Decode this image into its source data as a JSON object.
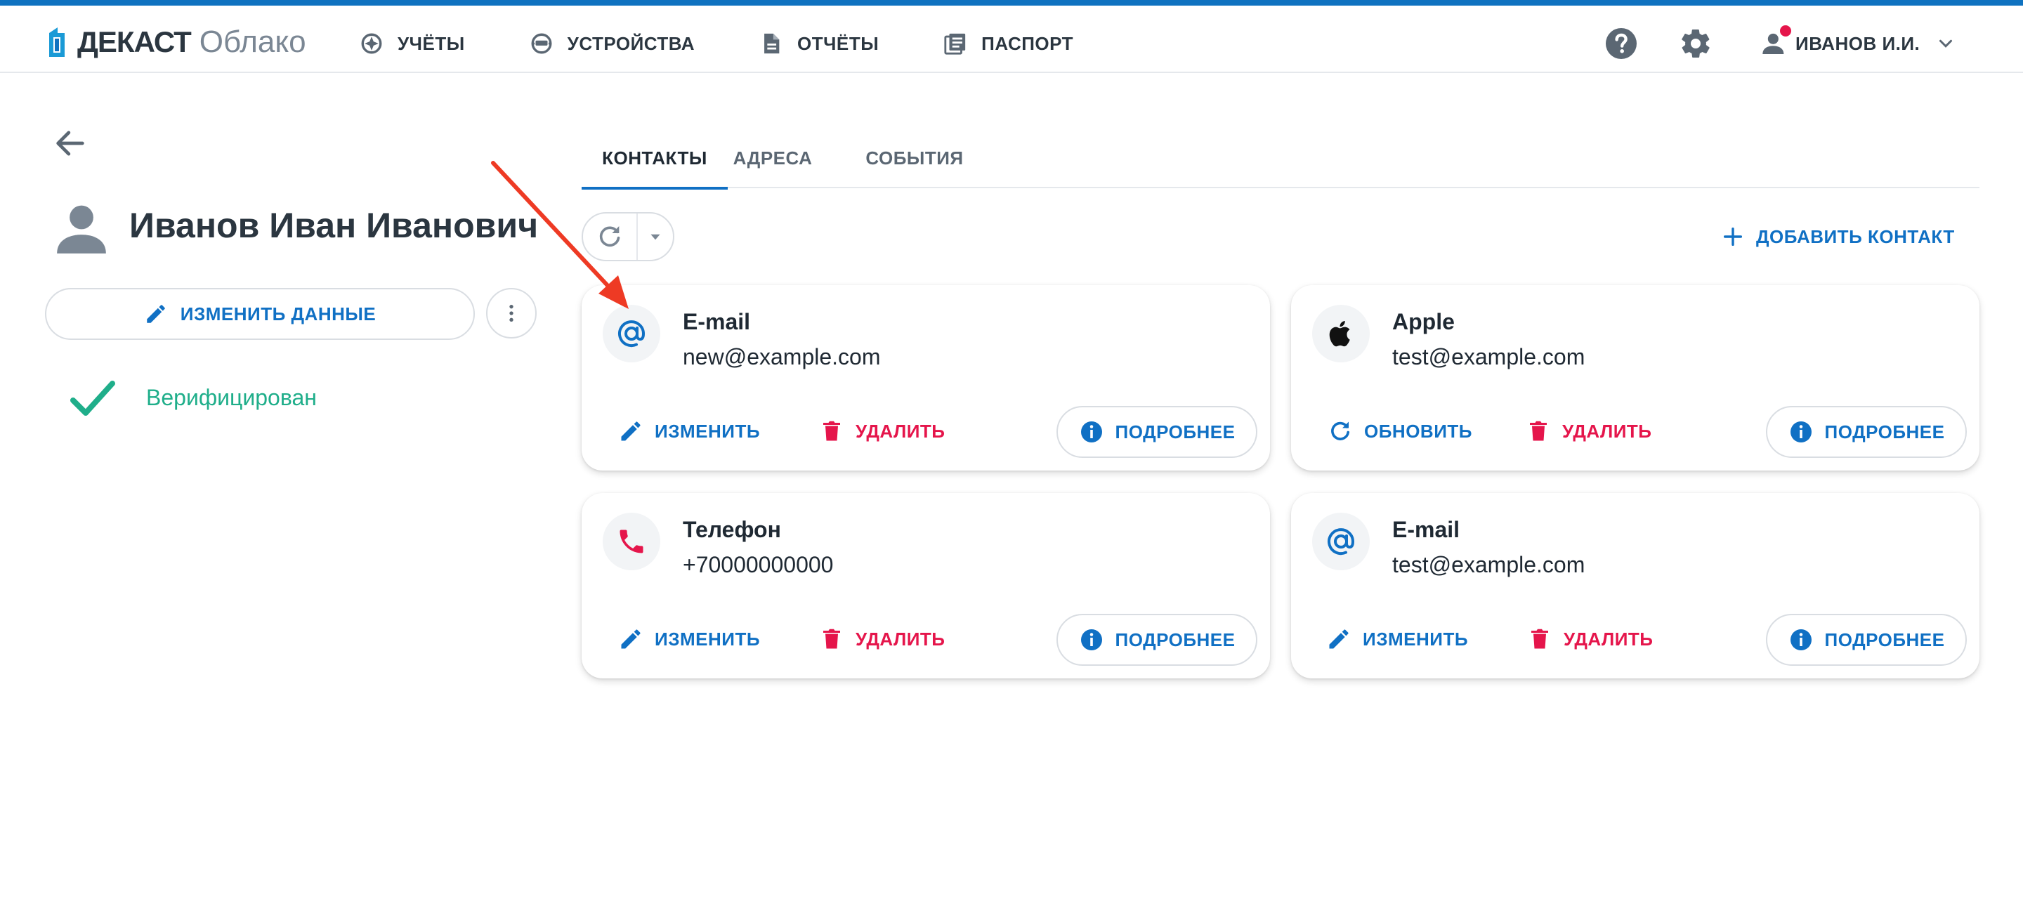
{
  "header": {
    "logo_main": "ДЕКАСТ",
    "logo_sub": "Облако",
    "nav": [
      {
        "label": "УЧЁТЫ",
        "icon": "accounts-icon"
      },
      {
        "label": "УСТРОЙСТВА",
        "icon": "devices-icon"
      },
      {
        "label": "ОТЧЁТЫ",
        "icon": "reports-icon"
      },
      {
        "label": "ПАСПОРТ",
        "icon": "passport-icon"
      }
    ],
    "user_name": "ИВАНОВ И.И."
  },
  "profile": {
    "name": "Иванов Иван Иванович",
    "edit_label": "ИЗМЕНИТЬ ДАННЫЕ",
    "status": "Верифицирован"
  },
  "tabs": [
    {
      "label": "КОНТАКТЫ",
      "active": true
    },
    {
      "label": "АДРЕСА",
      "active": false
    },
    {
      "label": "СОБЫТИЯ",
      "active": false
    }
  ],
  "toolbar": {
    "add_contact_label": "ДОБАВИТЬ КОНТАКТ"
  },
  "cards": [
    {
      "type": "E-mail",
      "value": "new@example.com",
      "icon": "at-icon",
      "primary_action": "ИЗМЕНИТЬ",
      "delete_action": "УДАЛИТЬ",
      "details_action": "ПОДРОБНЕЕ"
    },
    {
      "type": "Apple",
      "value": "test@example.com",
      "icon": "apple-icon",
      "primary_action": "ОБНОВИТЬ",
      "delete_action": "УДАЛИТЬ",
      "details_action": "ПОДРОБНЕЕ"
    },
    {
      "type": "Телефон",
      "value": "+70000000000",
      "icon": "phone-icon",
      "primary_action": "ИЗМЕНИТЬ",
      "delete_action": "УДАЛИТЬ",
      "details_action": "ПОДРОБНЕЕ"
    },
    {
      "type": "E-mail",
      "value": "test@example.com",
      "icon": "at-icon",
      "primary_action": "ИЗМЕНИТЬ",
      "delete_action": "УДАЛИТЬ",
      "details_action": "ПОДРОБНЕЕ"
    }
  ],
  "colors": {
    "accent": "#1070c4",
    "danger": "#e5154b",
    "success": "#1fae8a",
    "annotation_arrow": "#ee3a24"
  }
}
